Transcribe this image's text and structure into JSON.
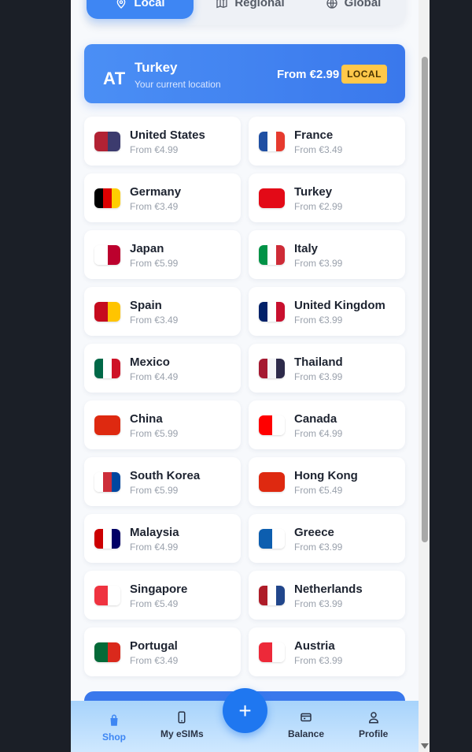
{
  "tabs": [
    {
      "label": "Local",
      "icon": "location-pin-icon",
      "active": true
    },
    {
      "label": "Regional",
      "icon": "map-icon",
      "active": false
    },
    {
      "label": "Global",
      "icon": "globe-icon",
      "active": false
    }
  ],
  "banner": {
    "code": "AT",
    "name": "Turkey",
    "subtitle": "Your current location",
    "price": "From €2.99",
    "badge": "LOCAL"
  },
  "countries": [
    {
      "name": "United States",
      "price": "From €4.99",
      "flag": [
        "#b22234",
        "#3c3b6e"
      ]
    },
    {
      "name": "France",
      "price": "From €3.49",
      "flag": [
        "#1f4fa3",
        "#ffffff",
        "#e63a2e"
      ]
    },
    {
      "name": "Germany",
      "price": "From €3.49",
      "flag": [
        "#000000",
        "#dd0000",
        "#ffce00"
      ]
    },
    {
      "name": "Turkey",
      "price": "From €2.99",
      "flag": [
        "#e30a17"
      ]
    },
    {
      "name": "Japan",
      "price": "From €5.99",
      "flag": [
        "#ffffff",
        "#bc002d"
      ]
    },
    {
      "name": "Italy",
      "price": "From €3.99",
      "flag": [
        "#009246",
        "#ffffff",
        "#ce2b37"
      ]
    },
    {
      "name": "Spain",
      "price": "From €3.49",
      "flag": [
        "#c60b1e",
        "#ffc400"
      ]
    },
    {
      "name": "United Kingdom",
      "price": "From €3.99",
      "flag": [
        "#012169",
        "#ffffff",
        "#c8102e"
      ]
    },
    {
      "name": "Mexico",
      "price": "From €4.49",
      "flag": [
        "#006847",
        "#ffffff",
        "#ce1126"
      ]
    },
    {
      "name": "Thailand",
      "price": "From €3.99",
      "flag": [
        "#a51931",
        "#f4f5f8",
        "#2d2a4a"
      ]
    },
    {
      "name": "China",
      "price": "From €5.99",
      "flag": [
        "#de2910"
      ]
    },
    {
      "name": "Canada",
      "price": "From €4.99",
      "flag": [
        "#ff0000",
        "#ffffff"
      ]
    },
    {
      "name": "South Korea",
      "price": "From €5.99",
      "flag": [
        "#ffffff",
        "#cd2e3a",
        "#0047a0"
      ]
    },
    {
      "name": "Hong Kong",
      "price": "From €5.49",
      "flag": [
        "#de2910"
      ]
    },
    {
      "name": "Malaysia",
      "price": "From €4.99",
      "flag": [
        "#cc0001",
        "#ffffff",
        "#010066"
      ]
    },
    {
      "name": "Greece",
      "price": "From €3.99",
      "flag": [
        "#0d5eaf",
        "#ffffff"
      ]
    },
    {
      "name": "Singapore",
      "price": "From €5.49",
      "flag": [
        "#ef3340",
        "#ffffff"
      ]
    },
    {
      "name": "Netherlands",
      "price": "From €3.99",
      "flag": [
        "#ae1c28",
        "#ffffff",
        "#21468b"
      ]
    },
    {
      "name": "Portugal",
      "price": "From €3.49",
      "flag": [
        "#046a38",
        "#da291c"
      ]
    },
    {
      "name": "Austria",
      "price": "From €3.99",
      "flag": [
        "#ed2939",
        "#ffffff"
      ]
    }
  ],
  "nav": {
    "shop": "Shop",
    "esims": "My eSIMs",
    "add": "+",
    "balance": "Balance",
    "profile": "Profile"
  },
  "colors": {
    "accent": "#3e86f3",
    "badge": "#ffc84a",
    "fab": "#1f77f0"
  }
}
